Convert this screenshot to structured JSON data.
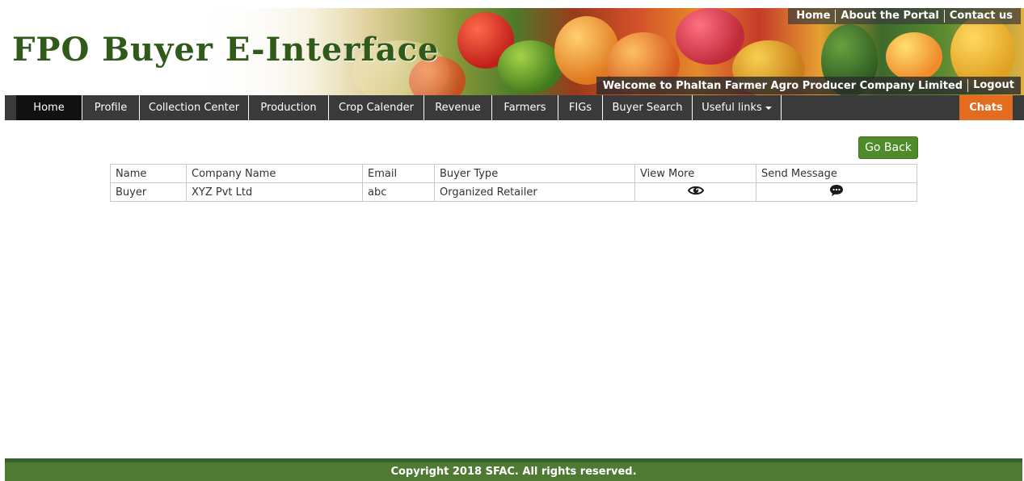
{
  "header": {
    "title": "FPO Buyer E-Interface",
    "top_links": [
      "Home",
      "About the Portal",
      "Contact us"
    ],
    "welcome_text": "Welcome to Phaltan Farmer Agro Producer Company Limited",
    "logout_label": "Logout"
  },
  "nav": {
    "items": [
      {
        "label": "Home"
      },
      {
        "label": "Profile"
      },
      {
        "label": "Collection Center"
      },
      {
        "label": "Production"
      },
      {
        "label": "Crop Calender"
      },
      {
        "label": "Revenue"
      },
      {
        "label": "Farmers"
      },
      {
        "label": "FIGs"
      },
      {
        "label": "Buyer Search"
      },
      {
        "label": "Useful links"
      }
    ],
    "active": "Home",
    "chats_label": "Chats"
  },
  "content": {
    "go_back_label": "Go Back",
    "table": {
      "headers": [
        "Name",
        "Company Name",
        "Email",
        "Buyer Type",
        "View More",
        "Send Message"
      ],
      "rows": [
        {
          "name": "Buyer",
          "company": "XYZ Pvt Ltd",
          "email": "abc",
          "buyer_type": "Organized Retailer",
          "view_icon": "eye-icon",
          "message_icon": "comment-icon"
        }
      ]
    }
  },
  "footer": {
    "copyright": "Copyright 2018 SFAC. All rights reserved."
  },
  "colors": {
    "nav_bg": "#3a3a3a",
    "nav_active": "#111111",
    "chats_bg": "#e46c1f",
    "button_green": "#4f8a2b",
    "footer_green": "#4e7a34",
    "title_green": "#2f5a1a"
  }
}
